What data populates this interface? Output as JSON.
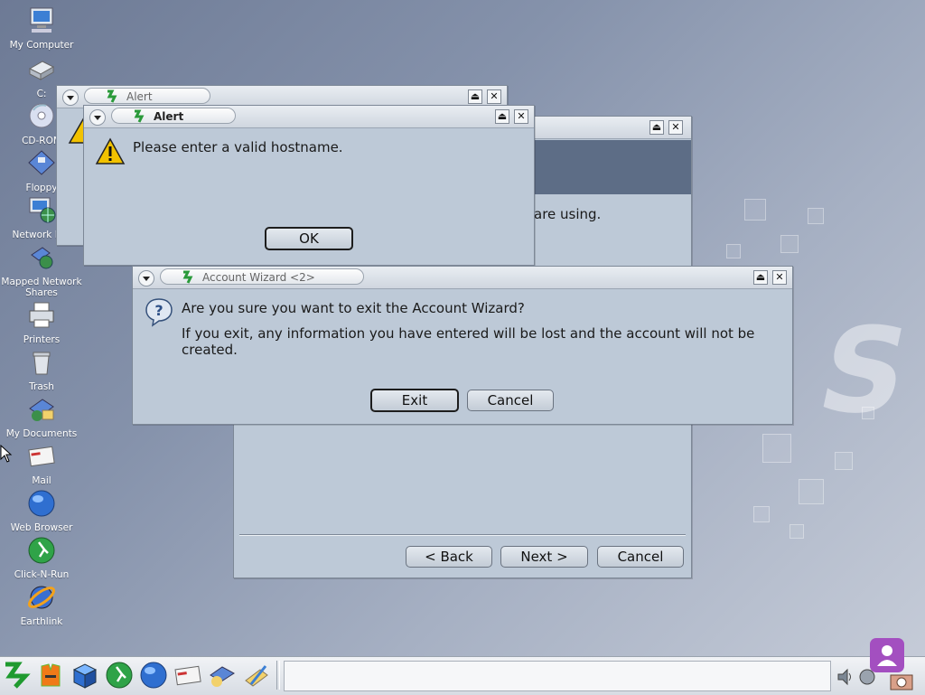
{
  "desktop": {
    "icons": [
      {
        "name": "my-computer-icon",
        "label": "My Computer"
      },
      {
        "name": "drive-c-icon",
        "label": "C:"
      },
      {
        "name": "cd-rom-icon",
        "label": "CD-ROM"
      },
      {
        "name": "floppy-icon",
        "label": "Floppy"
      },
      {
        "name": "network-browser-icon",
        "label": "Network Bro"
      },
      {
        "name": "mapped-network-shares-icon",
        "label": "Mapped Network Shares"
      },
      {
        "name": "printers-icon",
        "label": "Printers"
      },
      {
        "name": "trash-icon",
        "label": "Trash"
      },
      {
        "name": "my-documents-icon",
        "label": "My Documents"
      },
      {
        "name": "mail-icon",
        "label": "Mail"
      },
      {
        "name": "web-browser-icon",
        "label": "Web Browser"
      },
      {
        "name": "click-n-run-icon",
        "label": "Click-N-Run"
      },
      {
        "name": "earthlink-icon",
        "label": "Earthlink"
      }
    ]
  },
  "wizard_window": {
    "visible_text": "are using.",
    "back_label": "< Back",
    "next_label": "Next >",
    "cancel_label": "Cancel"
  },
  "alert_back": {
    "title": "Alert"
  },
  "alert_front": {
    "title": "Alert",
    "message": "Please enter a valid hostname.",
    "ok_label": "OK"
  },
  "confirm_dialog": {
    "title": "Account Wizard <2>",
    "question": "Are you sure you want to exit the Account Wizard?",
    "detail": "If you exit, any information you have entered will be lost and the account will not be created.",
    "exit_label": "Exit",
    "cancel_label": "Cancel"
  },
  "window_controls": {
    "maximize_glyph": "⏏",
    "close_glyph": "✕"
  },
  "colors": {
    "desktop": "#8592ab",
    "dialog_body": "#bdc9d7",
    "wizard_header": "#5d6d86"
  }
}
